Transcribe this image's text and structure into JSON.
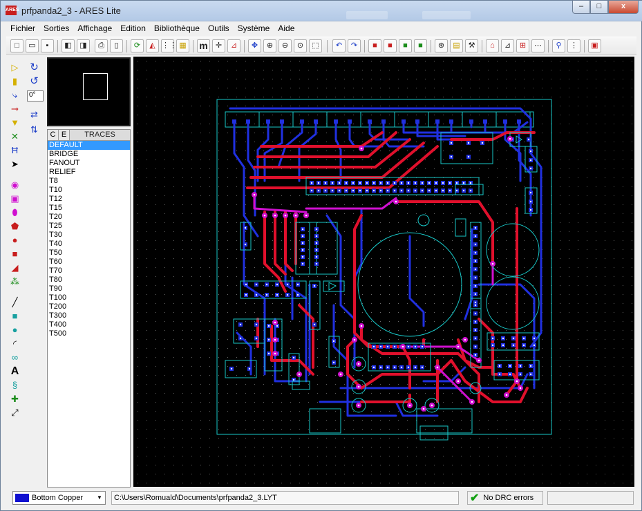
{
  "window": {
    "logo_text": "ARES",
    "title": "prfpanda2_3 - ARES Lite",
    "controls": {
      "minimize": "–",
      "maximize": "□",
      "close": "x"
    }
  },
  "menu": [
    "Fichier",
    "Sorties",
    "Affichage",
    "Edition",
    "Bibliothèque",
    "Outils",
    "Système",
    "Aide"
  ],
  "toolbar_icons": [
    "new-file-icon",
    "open-folder-icon",
    "save-icon",
    "import-icon",
    "export-icon",
    "print-icon",
    "page-icon",
    "refresh-icon",
    "flip-icon",
    "grid-icon",
    "layers-icon",
    "metric-icon",
    "origin-icon",
    "zoom-axis-icon",
    "pan-icon",
    "zoom-in-icon",
    "zoom-out-icon",
    "zoom-extent-icon",
    "zoom-area-icon",
    "undo-icon",
    "redo-icon",
    "cut-icon",
    "copy-icon",
    "paste-icon",
    "delete-icon",
    "pick-icon",
    "library-icon",
    "tools-icon",
    "autoroute-icon",
    "place-icon",
    "power-icon",
    "netlist-icon",
    "search-icon",
    "block-icon",
    "report-icon"
  ],
  "left_tools": [
    "component-icon",
    "package-icon",
    "track-icon",
    "via-icon",
    "zone-icon",
    "ratsnest-icon",
    "connectivity-icon",
    "select-icon",
    "round-pad-icon",
    "square-pad-icon",
    "dil-pad-icon",
    "edge-pad-icon",
    "circle-pad-icon",
    "rect-pad-icon",
    "polygon-pad-icon",
    "padstack-icon",
    "line-icon",
    "box-icon",
    "circle-icon",
    "arc-icon",
    "path-icon",
    "text-icon",
    "symbol-icon",
    "marker-icon",
    "dimension-icon"
  ],
  "rotation": {
    "angle": "0°",
    "rotate_cw": "↻",
    "rotate_ccw": "↺",
    "mirror_h": "⇄",
    "mirror_v": "⇅"
  },
  "traces": {
    "header_c": "C",
    "header_e": "E",
    "title": "TRACES",
    "items": [
      "DEFAULT",
      "BRIDGE",
      "FANOUT",
      "RELIEF",
      "T8",
      "T10",
      "T12",
      "T15",
      "T20",
      "T25",
      "T30",
      "T40",
      "T50",
      "T60",
      "T70",
      "T80",
      "T90",
      "T100",
      "T200",
      "T300",
      "T400",
      "T500"
    ],
    "selected_index": 0
  },
  "status": {
    "layer": "Bottom Copper",
    "layer_color": "#1010d0",
    "path": "C:\\Users\\Romuald\\Documents\\prfpanda2_3.LYT",
    "drc": "No DRC errors"
  },
  "colors": {
    "top_copper": "#e0102c",
    "bottom_copper": "#2030e0",
    "via": "#d010d0",
    "silk": "#18c8c8",
    "pad": "#2030e0"
  }
}
